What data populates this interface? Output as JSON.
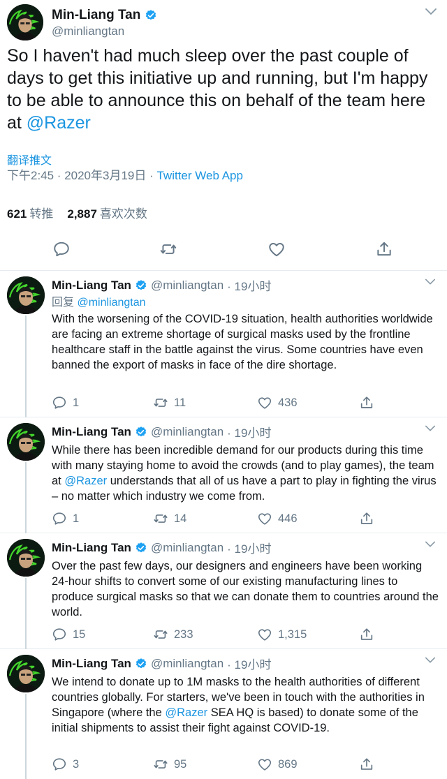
{
  "main": {
    "name": "Min-Liang Tan",
    "handle": "@minliangtan",
    "text_before": "So I haven't had much sleep over the past couple of days to get this initiative up and running, but I'm happy to be able to announce this on behalf of the team here at ",
    "mention": "@Razer",
    "translate": "翻译推文",
    "time_date": "下午2:45 · 2020年3月19日 · ",
    "client": "Twitter Web App",
    "retweets_count": "621",
    "retweets_label": "转推",
    "likes_count": "2,887",
    "likes_label": "喜欢次数"
  },
  "replies": [
    {
      "name": "Min-Liang Tan",
      "handle": "@minliangtan",
      "time": " · 19小时",
      "reply_to_prefix": "回复 ",
      "reply_to": "@minliangtan",
      "text": "With the worsening of the COVID-19 situation, health authorities worldwide are facing an extreme shortage of surgical masks used by the frontline healthcare staff in the battle against the virus. Some countries have even banned the export of masks in face of the dire shortage.",
      "replies": "1",
      "retweets": "11",
      "likes": "436"
    },
    {
      "name": "Min-Liang Tan",
      "handle": "@minliangtan",
      "time": " · 19小时",
      "text_before": "While there has been incredible demand for our products during this time with many staying home to avoid the crowds (and to play games), the team at ",
      "mention": "@Razer",
      "text_after": "  understands that all of us have a part to play in fighting the virus – no matter which industry we come from.",
      "replies": "1",
      "retweets": "14",
      "likes": "446"
    },
    {
      "name": "Min-Liang Tan",
      "handle": "@minliangtan",
      "time": " · 19小时",
      "text": "Over the past few days, our designers and engineers have been working 24-hour shifts to convert some of our existing manufacturing lines to produce surgical masks so that we can donate them to countries around the world.",
      "replies": "15",
      "retweets": "233",
      "likes": "1,315"
    },
    {
      "name": "Min-Liang Tan",
      "handle": "@minliangtan",
      "time": " · 19小时",
      "text_before": "We intend to donate up to 1M masks to the health authorities of different countries globally. For starters, we've been in touch with the authorities in Singapore (where the ",
      "mention": "@Razer",
      "text_after": " SEA HQ is based) to donate some of the initial shipments to assist their fight against COVID-19.",
      "replies": "3",
      "retweets": "95",
      "likes": "869"
    }
  ],
  "colors": {
    "link": "#1b95e0",
    "muted": "#657786",
    "verified": "#1da1f2",
    "avatar_green": "#44d62c"
  },
  "icons": [
    "verified-badge-icon",
    "chevron-down-icon",
    "reply-icon",
    "retweet-icon",
    "like-icon",
    "share-icon"
  ]
}
